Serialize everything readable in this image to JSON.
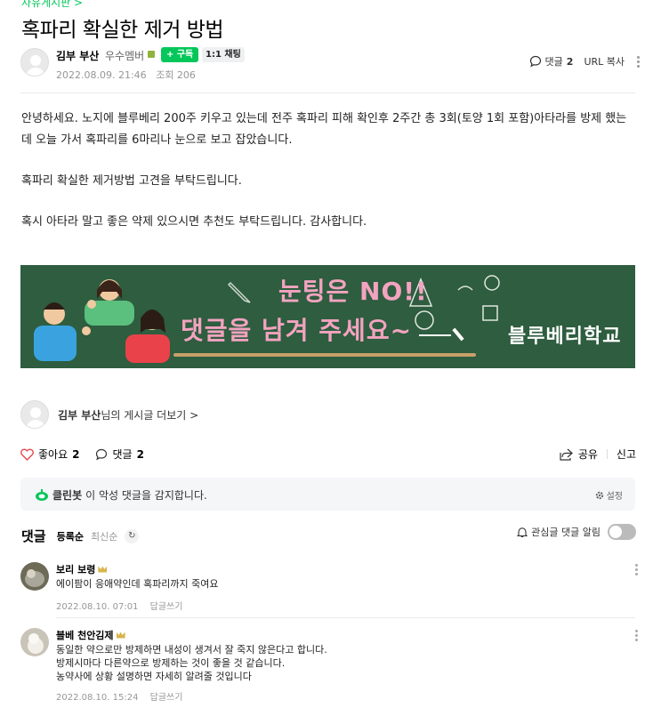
{
  "board_link": "자유게시판 >",
  "post": {
    "title": "혹파리 확실한 제거 방법",
    "author": "김부 부산",
    "grade": "우수멤버",
    "subscribe_label": "+ 구독",
    "chat_label": "1:1 채팅",
    "date": "2022.08.09. 21:46",
    "views": "조회 206",
    "comment_label": "댓글",
    "comment_count": "2",
    "url_copy": "URL 복사",
    "body": [
      "안녕하세요. 노지에 블루베리 200주 키우고 있는데 전주 혹파리 피해 확인후 2주간 총 3회(토양 1회 포함)아타라를 방제 했는데 오늘 가서 혹파리를 6마리나 눈으로 보고 잡았습니다.",
      "혹파리 확실한 제거방법 고견을 부탁드립니다.",
      "혹시 아타라 말고 좋은 약제 있으시면 추천도 부탁드립니다. 감사합니다."
    ]
  },
  "banner": {
    "line1": "눈팅은 NO!!",
    "line2": "댓글을 남겨 주세요~",
    "brand": "블루베리학교",
    "bg_color": "#2e5d3f",
    "accent_color": "#f3a3c0"
  },
  "more_posts": {
    "author": "김부 부산",
    "suffix": "님의 게시글 더보기 >"
  },
  "actions": {
    "like_label": "좋아요",
    "like_count": "2",
    "comment_label": "댓글",
    "comment_count": "2",
    "share_label": "공유",
    "report_label": "신고"
  },
  "cleanbot": {
    "name": "클린봇",
    "message": "이 악성 댓글을 감지합니다.",
    "settings": "설정"
  },
  "comments_section": {
    "heading": "댓글",
    "sort_registered": "등록순",
    "sort_latest": "최신순",
    "notify_label": "관심글 댓글 알림"
  },
  "comments": [
    {
      "name": "보리 보령",
      "text": [
        "에이팜이 응애약인데 혹파리까지 죽여요"
      ],
      "date": "2022.08.10. 07:01",
      "reply": "답글쓰기"
    },
    {
      "name": "블베 천안김제",
      "text": [
        "동일한 약으로만 방제하면 내성이 생겨서 잘 죽지 않은다고 합니다.",
        "방제시마다 다른약으로 방제하는 것이 좋을 것 같습니다.",
        "농약사에 상황 설명하면 자세히 알려줄 것입니다"
      ],
      "date": "2022.08.10. 15:24",
      "reply": "답글쓰기"
    }
  ]
}
